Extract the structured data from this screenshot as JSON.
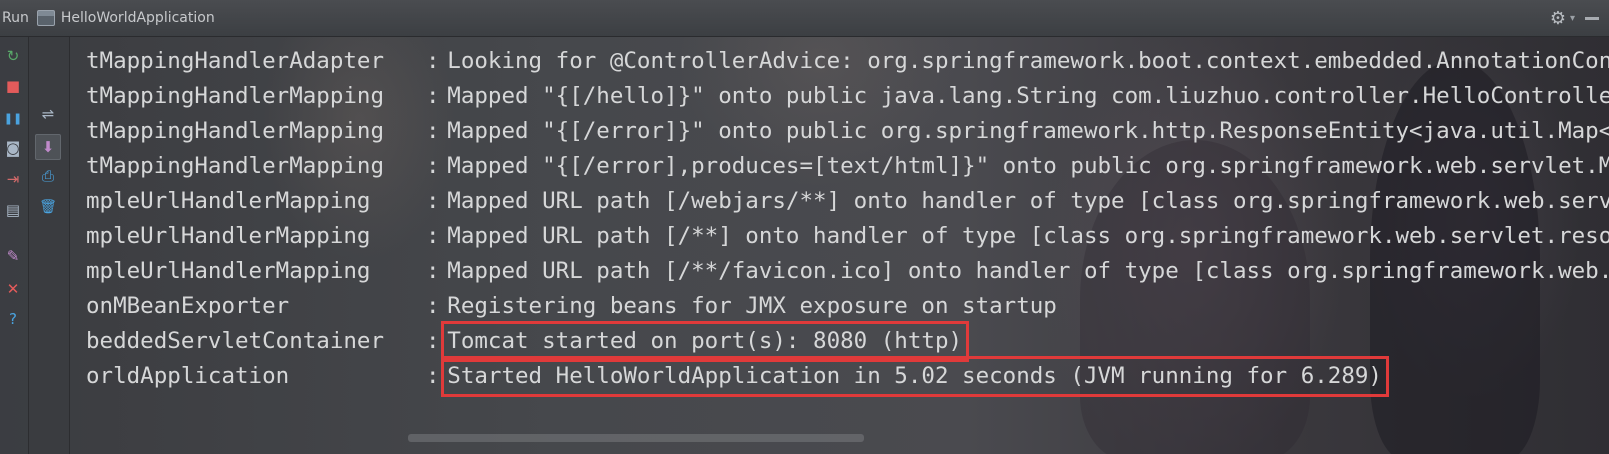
{
  "titlebar": {
    "run_label": "Run",
    "app_name": "HelloWorldApplication",
    "gear_icon": "gear-icon",
    "gear_caret": "▾"
  },
  "left_toolbar": [
    {
      "name": "rerun-icon",
      "glyph": "↻",
      "color": "#59a869"
    },
    {
      "name": "stop-icon",
      "glyph": "■",
      "color": "#e35b5b"
    },
    {
      "name": "pause-icon",
      "glyph": "❚❚",
      "color": "#4aa3df"
    },
    {
      "name": "camera-icon",
      "glyph": "◙",
      "color": "#a9b7c6"
    },
    {
      "name": "exit-icon",
      "glyph": "⇥",
      "color": "#d26a6a"
    },
    {
      "name": "layout-icon",
      "glyph": "▤",
      "color": "#a9b7c6"
    },
    {
      "name": "pin-icon",
      "glyph": "✎",
      "color": "#c08acb"
    },
    {
      "name": "close-icon",
      "glyph": "✕",
      "color": "#e35b5b"
    },
    {
      "name": "help-icon",
      "glyph": "?",
      "color": "#4aa3df"
    }
  ],
  "second_toolbar": [
    {
      "name": "soft-wrap-icon",
      "glyph": "⇌",
      "color": "#a9b7c6"
    },
    {
      "name": "scroll-to-end-icon",
      "glyph": "⬇",
      "color": "#c08acb"
    },
    {
      "name": "print-icon",
      "glyph": "⎙",
      "color": "#4aa3df"
    },
    {
      "name": "clear-all-icon",
      "glyph": "🗑",
      "color": "#4aa3df"
    }
  ],
  "console_lines": [
    {
      "logger": "tMappingHandlerAdapter",
      "message": "Looking for @ControllerAdvice: org.springframework.boot.context.embedded.AnnotationConfigEmbeddedWebApplicationContext",
      "highlight": false
    },
    {
      "logger": "tMappingHandlerMapping",
      "message": "Mapped \"{[/hello]}\" onto public java.lang.String com.liuzhuo.controller.HelloController.hello()",
      "highlight": false
    },
    {
      "logger": "tMappingHandlerMapping",
      "message": "Mapped \"{[/error]}\" onto public org.springframework.http.ResponseEntity<java.util.Map<java.lang.String, java.lang.Object>>",
      "highlight": false
    },
    {
      "logger": "tMappingHandlerMapping",
      "message": "Mapped \"{[/error],produces=[text/html]}\" onto public org.springframework.web.servlet.ModelAndView",
      "highlight": false
    },
    {
      "logger": "mpleUrlHandlerMapping ",
      "message": "Mapped URL path [/webjars/**] onto handler of type [class org.springframework.web.servlet.resource.ResourceHttpRequestHandler]",
      "highlight": false
    },
    {
      "logger": "mpleUrlHandlerMapping ",
      "message": "Mapped URL path [/**] onto handler of type [class org.springframework.web.servlet.resource.ResourceHttpRequestHandler]",
      "highlight": false
    },
    {
      "logger": "mpleUrlHandlerMapping ",
      "message": "Mapped URL path [/**/favicon.ico] onto handler of type [class org.springframework.web.servlet.resource.ResourceHttpRequestHandler]",
      "highlight": false
    },
    {
      "logger": "onMBeanExporter",
      "message": "Registering beans for JMX exposure on startup",
      "highlight": false
    },
    {
      "logger": "beddedServletContainer",
      "message": "Tomcat started on port(s): 8080 (http)",
      "highlight": true
    },
    {
      "logger": "orldApplication",
      "message": "Started HelloWorldApplication in 5.02 seconds (JVM running for 6.289)",
      "highlight": true
    }
  ],
  "separator": ":",
  "colors": {
    "highlight_box": "#e03a3a",
    "console_text": "#d6d7d8"
  }
}
